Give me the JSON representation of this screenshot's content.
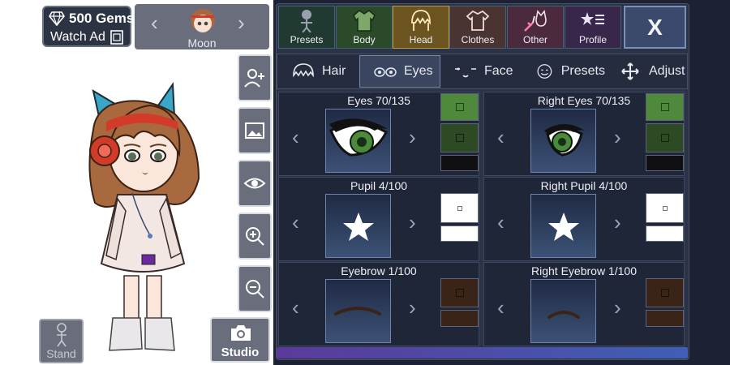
{
  "wallet": {
    "gems_label": "500 Gems",
    "watch_ad_label": "Watch Ad",
    "gem_icon": "diamond-icon",
    "ad_icon": "film-icon"
  },
  "character_slot": {
    "name": "Moon",
    "prev_icon": "chevron-left-icon",
    "next_icon": "chevron-right-icon"
  },
  "side_tools": [
    {
      "icon": "add-person-icon"
    },
    {
      "icon": "image-icon"
    },
    {
      "icon": "eye-icon"
    },
    {
      "icon": "zoom-in-icon"
    },
    {
      "icon": "zoom-out-icon"
    }
  ],
  "stand_label": "Stand",
  "studio_label": "Studio",
  "categories": [
    {
      "label": "Presets",
      "icon": "figure-icon",
      "bg": "#203a32"
    },
    {
      "label": "Body",
      "icon": "jacket-icon",
      "bg": "#2a4a2a"
    },
    {
      "label": "Head",
      "icon": "hair-icon",
      "bg": "#6b5420"
    },
    {
      "label": "Clothes",
      "icon": "shirt-icon",
      "bg": "#4a3432"
    },
    {
      "label": "Other",
      "icon": "sword-cat-icon",
      "bg": "#4a2a3c"
    },
    {
      "label": "Profile",
      "icon": "star-list-icon",
      "bg": "#38274a"
    }
  ],
  "close_label": "X",
  "head_tabs": [
    {
      "label": "Hair",
      "icon": "hair-outline-icon"
    },
    {
      "label": "Eyes",
      "icon": "eyes-outline-icon"
    },
    {
      "label": "Face",
      "icon": "face-outline-icon"
    },
    {
      "label": "Presets",
      "icon": "smiley-icon"
    },
    {
      "label": "Adjust",
      "icon": "move-icon"
    }
  ],
  "options": {
    "eyes": "Eyes 70/135",
    "right_eyes": "Right Eyes 70/135",
    "pupil": "Pupil 4/100",
    "right_pupil": "Right Pupil 4/100",
    "eyebrow": "Eyebrow 1/100",
    "right_eyebrow": "Right Eyebrow 1/100"
  },
  "colors": {
    "eye_swatches": [
      "#4f8a3c",
      "#2d4a24",
      "#101012"
    ],
    "pupil_swatches": [
      "#ffffff",
      "#ffffff"
    ],
    "eyebrow_swatches": [
      "#3a2418",
      "#3a2418"
    ],
    "active_tab": "#6b5420",
    "panel_bg": "#1c2233"
  }
}
